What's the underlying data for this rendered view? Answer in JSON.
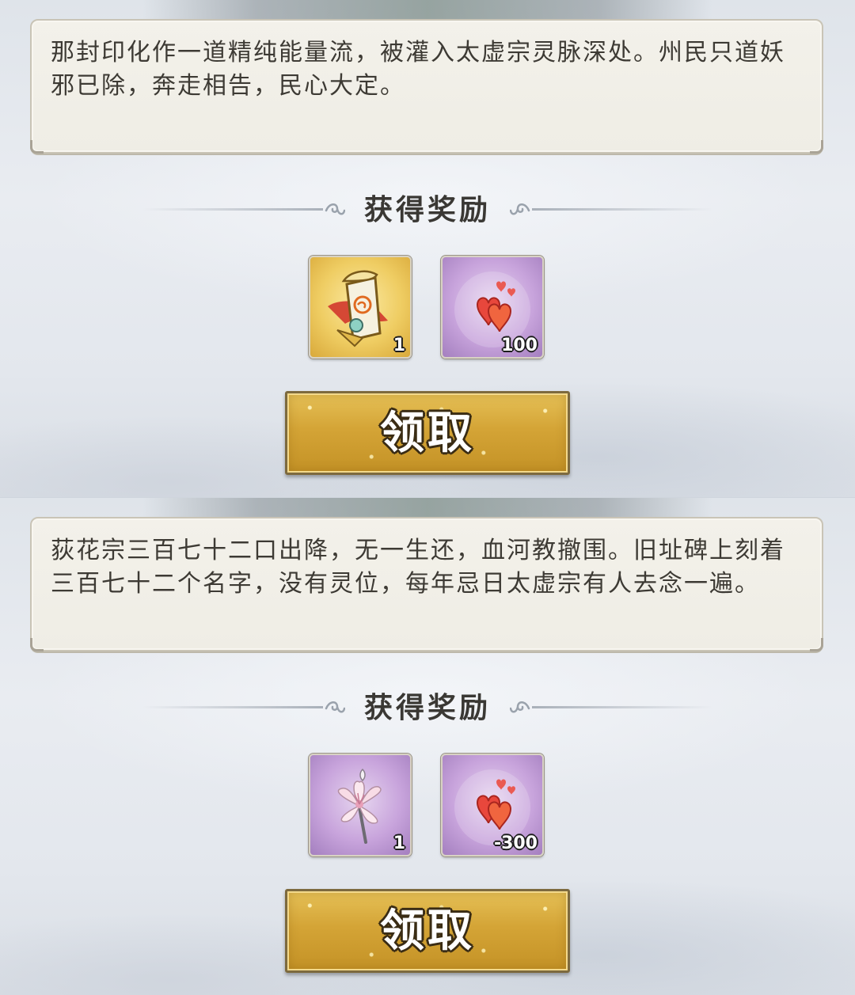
{
  "quests": [
    {
      "story_text": "那封印化作一道精纯能量流，被灌入太虚宗灵脉深处。州民只道妖邪已除，奔走相告，民心大定。",
      "reward_title": "获得奖励",
      "rewards": [
        {
          "icon": "talisman-scroll-icon",
          "count": "1",
          "frame_color": "#efcd63"
        },
        {
          "icon": "hearts-icon",
          "count": "100",
          "frame_color": "#c8a4dc"
        }
      ],
      "claim_label": "领取"
    },
    {
      "story_text": "荻花宗三百七十二口出降，无一生还，血河教撤围。旧址碑上刻着三百七十二个名字，没有灵位，每年忌日太虚宗有人去念一遍。",
      "reward_title": "获得奖励",
      "rewards": [
        {
          "icon": "lily-flower-icon",
          "count": "1",
          "frame_color": "#c8a4dc"
        },
        {
          "icon": "hearts-icon",
          "count": "-300",
          "frame_color": "#c8a4dc"
        }
      ],
      "claim_label": "领取"
    }
  ]
}
